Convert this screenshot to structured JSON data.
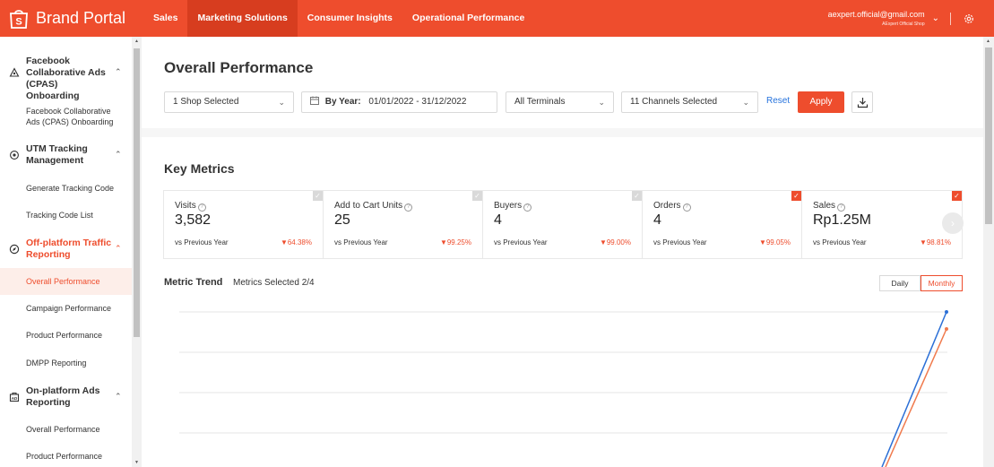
{
  "brand": {
    "name": "Brand Portal"
  },
  "nav": [
    "Sales",
    "Marketing Solutions",
    "Consumer Insights",
    "Operational Performance"
  ],
  "account": {
    "email": "aexpert.official@gmail.com",
    "shop": "AExpert Official Shop"
  },
  "sidebar": {
    "groups": [
      {
        "label": "Facebook Collaborative Ads (CPAS) Onboarding",
        "items": [
          "Facebook Collaborative Ads (CPAS) Onboarding"
        ]
      },
      {
        "label": "UTM Tracking Management",
        "items": [
          "Generate Tracking Code",
          "Tracking Code List"
        ]
      },
      {
        "label": "Off-platform Traffic Reporting",
        "items": [
          "Overall Performance",
          "Campaign Performance",
          "Product Performance",
          "DMPP Reporting"
        ]
      },
      {
        "label": "On-platform Ads Reporting",
        "items": [
          "Overall Performance",
          "Product Performance"
        ]
      }
    ],
    "active_item": "Overall Performance"
  },
  "page": {
    "title": "Overall Performance",
    "filters": {
      "shop": "1 Shop Selected",
      "date_label": "By Year:",
      "date_range": "01/01/2022 - 31/12/2022",
      "terminals": "All Terminals",
      "channels": "11 Channels Selected",
      "reset": "Reset",
      "apply": "Apply"
    }
  },
  "key_metrics": {
    "title": "Key Metrics",
    "cards": [
      {
        "label": "Visits",
        "value": "3,582",
        "compare": "vs Previous Year",
        "delta": "▼64.38%",
        "checked": false
      },
      {
        "label": "Add to Cart Units",
        "value": "25",
        "compare": "vs Previous Year",
        "delta": "▼99.25%",
        "checked": false
      },
      {
        "label": "Buyers",
        "value": "4",
        "compare": "vs Previous Year",
        "delta": "▼99.00%",
        "checked": false
      },
      {
        "label": "Orders",
        "value": "4",
        "compare": "vs Previous Year",
        "delta": "▼99.05%",
        "checked": true
      },
      {
        "label": "Sales",
        "value": "Rp1.25M",
        "compare": "vs Previous Year",
        "delta": "▼98.81%",
        "checked": true
      }
    ]
  },
  "metric_trend": {
    "title": "Metric Trend",
    "selected": "Metrics Selected 2/4",
    "toggle": {
      "daily": "Daily",
      "monthly": "Monthly",
      "active": "Monthly"
    }
  },
  "colors": {
    "accent": "#ee4d2d",
    "series_orders": "#2b6fd6",
    "series_sales": "#f07a4d"
  },
  "icons": {
    "brand": "shopping-bag-icon",
    "settings": "gear-icon",
    "calendar": "calendar-icon",
    "download": "download-icon"
  }
}
